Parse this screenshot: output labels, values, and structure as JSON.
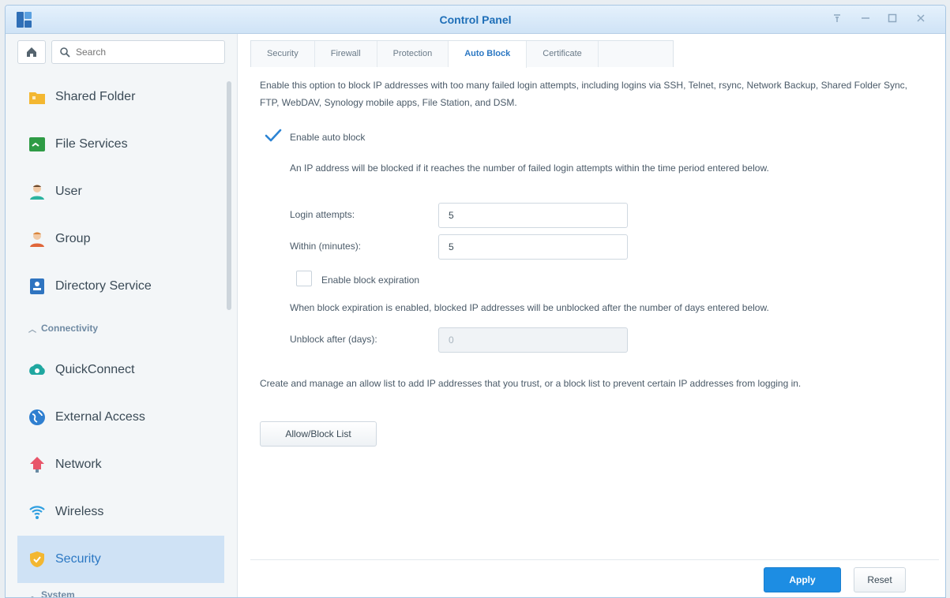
{
  "window": {
    "title": "Control Panel"
  },
  "sidebar": {
    "search_placeholder": "Search",
    "items": [
      {
        "label": "Shared Folder"
      },
      {
        "label": "File Services"
      },
      {
        "label": "User"
      },
      {
        "label": "Group"
      },
      {
        "label": "Directory Service"
      }
    ],
    "section_connectivity": "Connectivity",
    "items2": [
      {
        "label": "QuickConnect"
      },
      {
        "label": "External Access"
      },
      {
        "label": "Network"
      },
      {
        "label": "Wireless"
      },
      {
        "label": "Security"
      }
    ],
    "section_system": "System"
  },
  "tabs": [
    "Security",
    "Firewall",
    "Protection",
    "Auto Block",
    "Certificate"
  ],
  "auto_block": {
    "intro": "Enable this option to block IP addresses with too many failed login attempts, including logins via SSH, Telnet, rsync, Network Backup, Shared Folder Sync, FTP, WebDAV, Synology mobile apps, File Station, and DSM.",
    "enable_label": "Enable auto block",
    "enable_checked": true,
    "rule_desc": "An IP address will be blocked if it reaches the number of failed login attempts within the time period entered below.",
    "login_attempts_label": "Login attempts:",
    "login_attempts_value": "5",
    "within_label": "Within (minutes):",
    "within_value": "5",
    "expiration_label": "Enable block expiration",
    "expiration_checked": false,
    "expiration_desc": "When block expiration is enabled, blocked IP addresses will be unblocked after the number of days entered below.",
    "unblock_label": "Unblock after (days):",
    "unblock_value": "0",
    "list_desc": "Create and manage an allow list to add IP addresses that you trust, or a block list to prevent certain IP addresses from logging in.",
    "list_button": "Allow/Block List"
  },
  "footer": {
    "apply": "Apply",
    "reset": "Reset"
  },
  "colors": {
    "accent": "#1d8de3",
    "title_blue": "#1f6fb8",
    "active_bg": "#cfe2f5"
  }
}
